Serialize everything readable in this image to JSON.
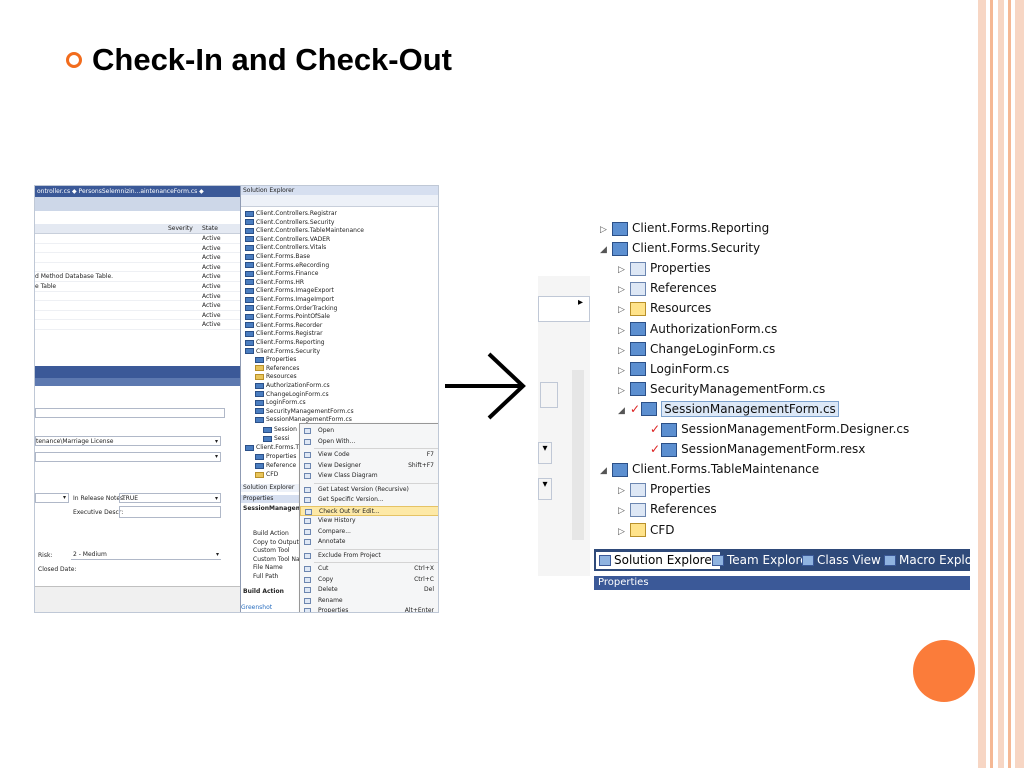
{
  "slide": {
    "title": "Check-In and Check-Out",
    "accent_color": "#f26c1d",
    "decor_colors": [
      "#f7d6c4",
      "#f5b894",
      "#fb7c3a"
    ]
  },
  "shot1": {
    "doc_tabs": "ontroller.cs  ◆   PersonsSelemnizin...aintenanceForm.cs  ◆",
    "error_list": {
      "headers": {
        "severity": "Severity",
        "state": "State"
      },
      "rows": [
        {
          "desc": "",
          "state": "Active"
        },
        {
          "desc": "",
          "state": "Active"
        },
        {
          "desc": "",
          "state": "Active"
        },
        {
          "desc": "",
          "state": "Active"
        },
        {
          "desc": "d Method Database Table.",
          "state": "Active"
        },
        {
          "desc": "e Table",
          "state": "Active"
        },
        {
          "desc": "",
          "state": "Active"
        },
        {
          "desc": "",
          "state": "Active"
        },
        {
          "desc": "",
          "state": "Active"
        },
        {
          "desc": "",
          "state": "Active"
        }
      ]
    },
    "form": {
      "license_field": "tenance\\Marriage License",
      "in_release_notes_label": "In Release Notes:",
      "in_release_notes_value": "TRUE",
      "executive_descr_label": "Executive Descr:",
      "risk_label": "Risk:",
      "risk_value": "2 - Medium",
      "closed_date_label": "Closed Date:"
    },
    "solution_explorer": {
      "title": "Solution Explorer",
      "items": [
        "Client.Controllers.Registrar",
        "Client.Controllers.Security",
        "Client.Controllers.TableMaintenance",
        "Client.Controllers.VADER",
        "Client.Controllers.Vitals",
        "Client.Forms.Base",
        "Client.Forms.eRecording",
        "Client.Forms.Finance",
        "Client.Forms.HR",
        "Client.Forms.ImageExport",
        "Client.Forms.ImageImport",
        "Client.Forms.OrderTracking",
        "Client.Forms.PointOfSale",
        "Client.Forms.Recorder",
        "Client.Forms.Registrar",
        "Client.Forms.Reporting",
        "Client.Forms.Security",
        "Properties",
        "References",
        "Resources",
        "AuthorizationForm.cs",
        "ChangeLoginForm.cs",
        "LoginForm.cs",
        "SecurityManagementForm.cs",
        "SessionManagementForm.cs"
      ],
      "lower_items": [
        "Session",
        "Sessi",
        "Client.Forms.T",
        "Properties",
        "Reference",
        "CFD"
      ],
      "tabs_label": "Solution Explorer",
      "properties_title": "Properties",
      "properties_object": "SessionManagement",
      "properties_rows": [
        "Build Action",
        "Copy to Output Di",
        "Custom Tool",
        "Custom Tool Name",
        "File Name",
        "Full Path"
      ],
      "build_action_title": "Build Action",
      "greenshot": "Greenshot"
    },
    "context_menu": [
      {
        "label": "Open",
        "shortcut": ""
      },
      {
        "label": "Open With...",
        "shortcut": ""
      },
      {
        "label": "View Code",
        "shortcut": "F7"
      },
      {
        "label": "View Designer",
        "shortcut": "Shift+F7"
      },
      {
        "label": "View Class Diagram",
        "shortcut": ""
      },
      {
        "label": "Get Latest Version (Recursive)",
        "shortcut": ""
      },
      {
        "label": "Get Specific Version...",
        "shortcut": ""
      },
      {
        "label": "Check Out for Edit...",
        "shortcut": ""
      },
      {
        "label": "View History",
        "shortcut": ""
      },
      {
        "label": "Compare...",
        "shortcut": ""
      },
      {
        "label": "Annotate",
        "shortcut": ""
      },
      {
        "label": "Exclude From Project",
        "shortcut": ""
      },
      {
        "label": "Cut",
        "shortcut": "Ctrl+X"
      },
      {
        "label": "Copy",
        "shortcut": "Ctrl+C"
      },
      {
        "label": "Delete",
        "shortcut": "Del"
      },
      {
        "label": "Rename",
        "shortcut": ""
      },
      {
        "label": "Properties",
        "shortcut": "Alt+Enter"
      }
    ],
    "highlighted_item": "Check Out for Edit..."
  },
  "arrow_icon": "right-arrow-icon",
  "shot2": {
    "items": [
      {
        "label": "Client.Forms.Reporting",
        "icon": "project",
        "expander": "▷"
      },
      {
        "label": "Client.Forms.Security",
        "icon": "project",
        "expander": "◢"
      },
      {
        "label": "Properties",
        "icon": "properties",
        "expander": "▷"
      },
      {
        "label": "References",
        "icon": "references",
        "expander": "▷"
      },
      {
        "label": "Resources",
        "icon": "folder",
        "expander": "▷"
      },
      {
        "label": "AuthorizationForm.cs",
        "icon": "form",
        "expander": "▷"
      },
      {
        "label": "ChangeLoginForm.cs",
        "icon": "form",
        "expander": "▷"
      },
      {
        "label": "LoginForm.cs",
        "icon": "form",
        "expander": "▷"
      },
      {
        "label": "SecurityManagementForm.cs",
        "icon": "form",
        "expander": "▷"
      },
      {
        "label": "SessionManagementForm.cs",
        "icon": "form",
        "expander": "◢"
      },
      {
        "label": "SessionManagementForm.Designer.cs",
        "icon": "code",
        "expander": ""
      },
      {
        "label": "SessionManagementForm.resx",
        "icon": "resx",
        "expander": ""
      },
      {
        "label": "Client.Forms.TableMaintenance",
        "icon": "project",
        "expander": "◢"
      },
      {
        "label": "Properties",
        "icon": "properties",
        "expander": "▷"
      },
      {
        "label": "References",
        "icon": "references",
        "expander": "▷"
      },
      {
        "label": "CFD",
        "icon": "folder",
        "expander": "▷"
      }
    ],
    "check_mark": "✓",
    "tabs": [
      "Solution Explorer",
      "Team Explorer",
      "Class View",
      "Macro Explor"
    ],
    "properties_label": "Properties"
  }
}
